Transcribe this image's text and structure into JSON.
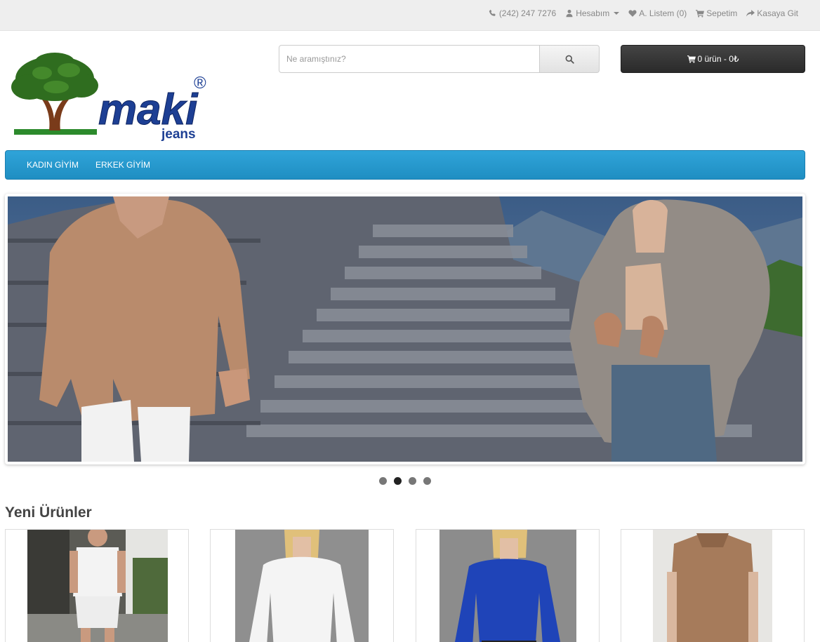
{
  "topbar": {
    "phone": "(242) 247 7276",
    "account": "Hesabım",
    "wishlist": "A. Listem (0)",
    "cart": "Sepetim",
    "checkout": "Kasaya Git"
  },
  "logo": {
    "brand": "maki",
    "sub": "jeans",
    "mark": "®"
  },
  "search": {
    "placeholder": "Ne aramıştınız?",
    "value": ""
  },
  "cart_button": {
    "label": "0 ürün - 0₺"
  },
  "menu": {
    "items": [
      {
        "label": "KADIN GİYİM"
      },
      {
        "label": "ERKEK GİYİM"
      }
    ]
  },
  "slideshow": {
    "slides": 4,
    "active_index": 1
  },
  "section": {
    "title": "Yeni Ürünler"
  },
  "products": [
    {
      "icon": "product-image-men-outfit"
    },
    {
      "icon": "product-image-white-top"
    },
    {
      "icon": "product-image-blue-top"
    },
    {
      "icon": "product-image-knit-vest"
    }
  ],
  "colors": {
    "menu": "#229ace",
    "cart_button": "#333333",
    "topbar": "#eeeeee"
  }
}
